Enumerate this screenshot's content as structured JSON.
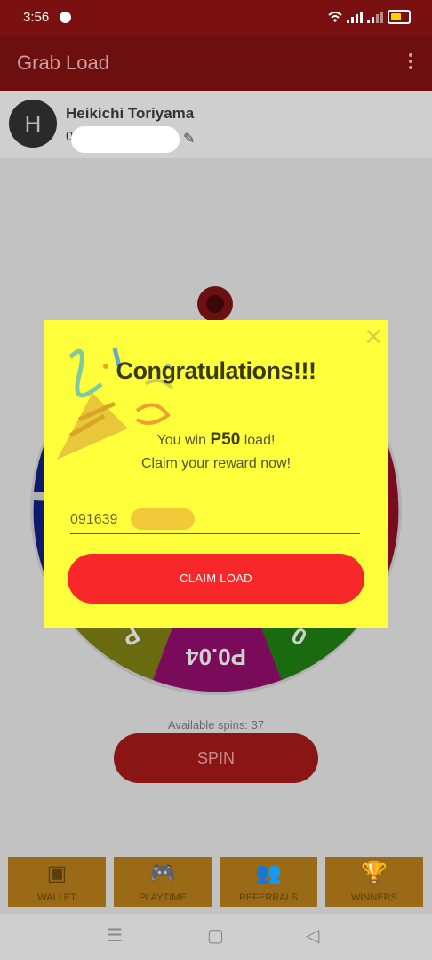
{
  "status": {
    "time": "3:56"
  },
  "app": {
    "title": "Grab Load"
  },
  "profile": {
    "initial": "H",
    "name": "Heikichi Toriyama",
    "number_prefix": "0"
  },
  "wheel": {
    "visible_label": "P0.04"
  },
  "main": {
    "spins_label": "Available spins: 37",
    "spin_button": "SPIN"
  },
  "tabs": [
    {
      "label": "WALLET",
      "icon": "wallet-icon"
    },
    {
      "label": "PLAYTIME",
      "icon": "gamepad-icon"
    },
    {
      "label": "REFERRALS",
      "icon": "people-icon"
    },
    {
      "label": "WINNERS",
      "icon": "trophy-icon"
    }
  ],
  "dialog": {
    "title": "Congratulations!!!",
    "win_prefix": "You win ",
    "amount": "P50",
    "win_suffix": " load!",
    "claim_text": "Claim your reward now!",
    "phone_value": "091639",
    "claim_button": "CLAIM LOAD"
  },
  "colors": {
    "dialog_bg": "#ffff3c",
    "claim_button": "#f8282a",
    "appbar": "#6e0f0f"
  }
}
